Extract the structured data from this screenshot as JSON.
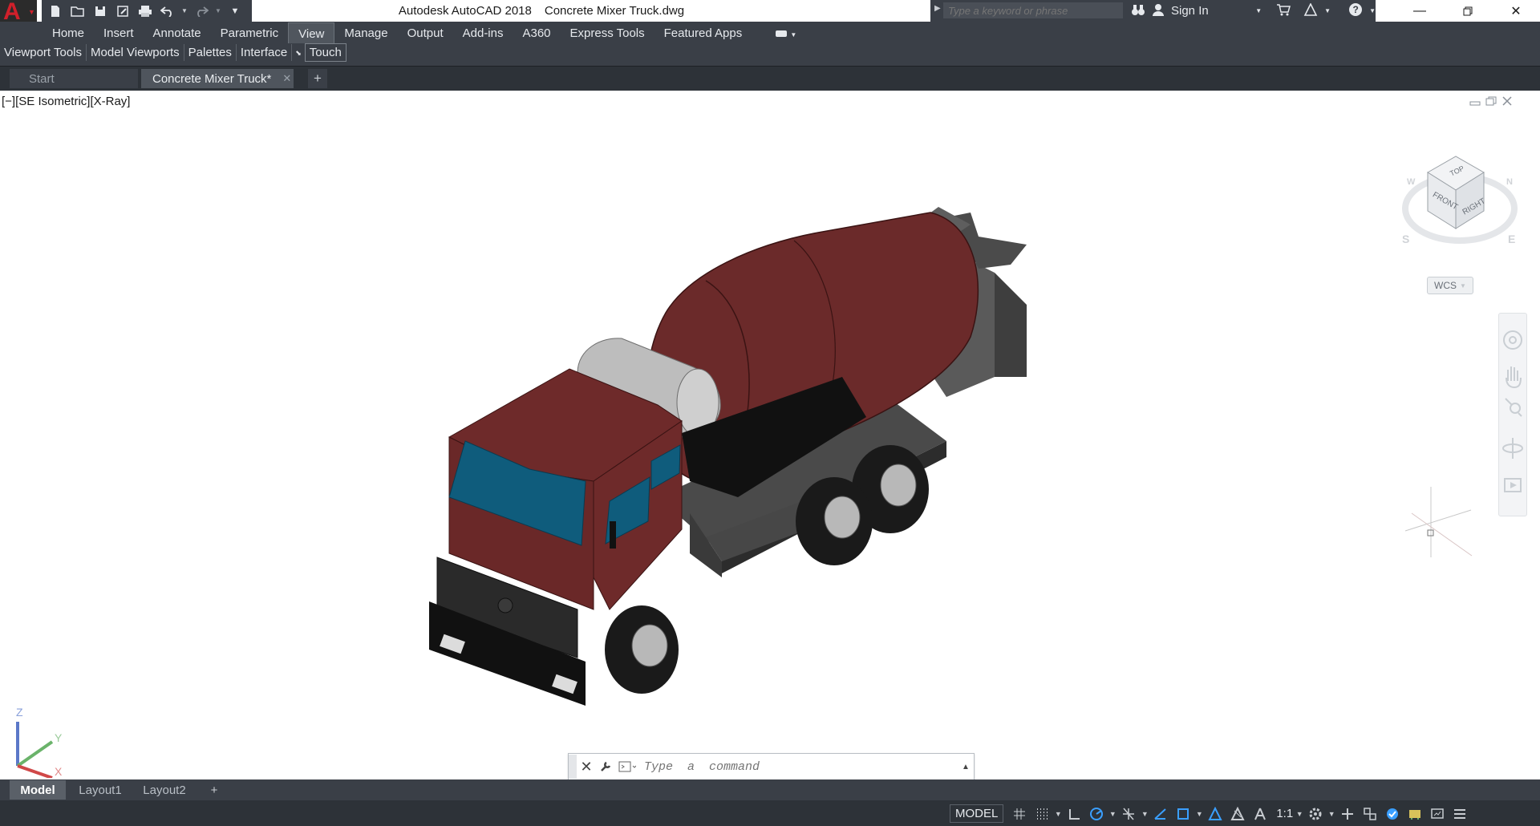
{
  "app": {
    "logo_letter": "A",
    "window_title": "Autodesk AutoCAD 2018",
    "file_name": "Concrete Mixer Truck.dwg"
  },
  "search": {
    "placeholder": "Type a keyword or phrase"
  },
  "account": {
    "sign_in_label": "Sign In"
  },
  "ribbon": {
    "tabs": [
      "Home",
      "Insert",
      "Annotate",
      "Parametric",
      "View",
      "Manage",
      "Output",
      "Add-ins",
      "A360",
      "Express Tools",
      "Featured Apps"
    ],
    "active_tab": "View",
    "panels": [
      "Viewport Tools",
      "Model Viewports",
      "Palettes",
      "Interface",
      "Touch"
    ]
  },
  "document_tabs": {
    "start_label": "Start",
    "active_label": "Concrete Mixer Truck*"
  },
  "viewport": {
    "label": "[−][SE Isometric][X-Ray]",
    "viewcube": {
      "top": "TOP",
      "front": "FRONT",
      "right": "RIGHT",
      "s": "S",
      "e": "E",
      "w": "W",
      "n": "N"
    },
    "wcs_label": "WCS",
    "ucs": {
      "z": "Z",
      "y": "Y",
      "x": "X"
    },
    "model_colors": {
      "body": "#6e2a2a",
      "glass": "#0f5c7c",
      "drum": "#6b2a2a",
      "chassis": "#4a4a4a",
      "tank": "#bdbdbd",
      "tire": "#1a1a1a"
    }
  },
  "command_line": {
    "placeholder": "Type  a  command"
  },
  "layout_tabs": {
    "model": "Model",
    "layout1": "Layout1",
    "layout2": "Layout2"
  },
  "status_bar": {
    "model_label": "MODEL",
    "annotation_scale": "1:1",
    "icons": [
      "grid-icon",
      "snap-icon",
      "ortho-icon",
      "polar-icon",
      "isodraft-icon",
      "osnap-icon",
      "otrack-icon",
      "lineweight-icon",
      "transparency-icon",
      "annotation-visibility-icon",
      "auto-scale-icon",
      "workspace-icon",
      "units-icon",
      "quick-properties-icon",
      "isolate-icon",
      "hardware-accel-icon",
      "clean-screen-icon",
      "customize-icon"
    ]
  }
}
